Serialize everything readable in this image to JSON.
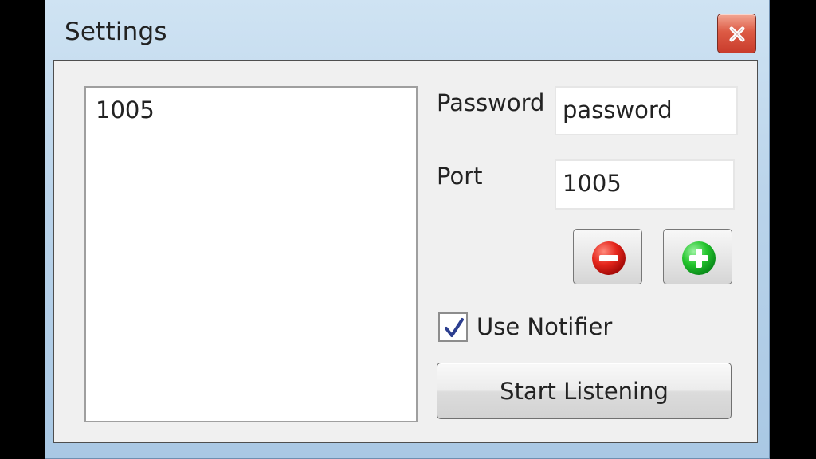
{
  "window": {
    "title": "Settings"
  },
  "server_list": {
    "items": [
      "1005"
    ]
  },
  "form": {
    "password_label": "Password",
    "password_value": "password",
    "port_label": "Port",
    "port_value": "1005",
    "remove_icon": "remove-icon",
    "add_icon": "add-icon",
    "use_notifier_label": "Use Notifier",
    "use_notifier_checked": true,
    "start_button_label": "Start Listening"
  },
  "colors": {
    "window_frame": "#b9d3ea",
    "dialog_bg": "#f0f0f0",
    "close_red": "#d84b38",
    "remove_red": "#d71f13",
    "add_green": "#20c22a",
    "check_blue": "#2c3e8f"
  }
}
